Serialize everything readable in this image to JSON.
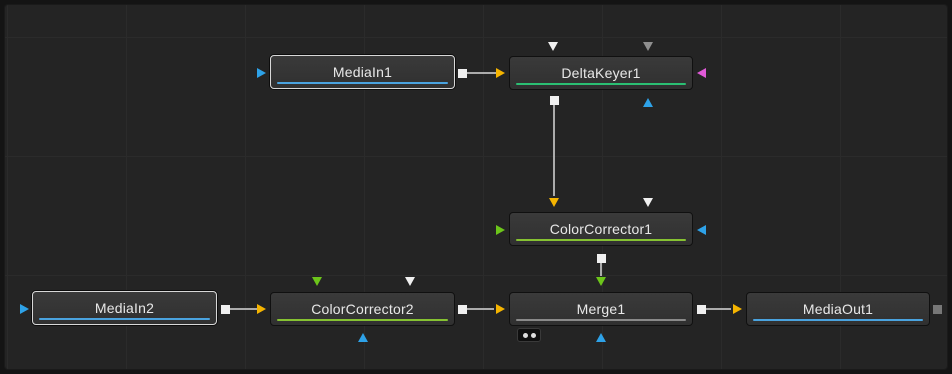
{
  "nodes": {
    "mediain1": {
      "label": "MediaIn1",
      "bar_color": "#4aa3df"
    },
    "deltakeyer1": {
      "label": "DeltaKeyer1",
      "bar_color": "#2bbf73"
    },
    "colorcorrector1": {
      "label": "ColorCorrector1",
      "bar_color": "#86c232"
    },
    "mediain2": {
      "label": "MediaIn2",
      "bar_color": "#4aa3df"
    },
    "colorcorrector2": {
      "label": "ColorCorrector2",
      "bar_color": "#86c232"
    },
    "merge1": {
      "label": "Merge1",
      "bar_color": "#8a8a8a"
    },
    "mediaout1": {
      "label": "MediaOut1",
      "bar_color": "#4aa3df"
    }
  },
  "port_colors": {
    "input_blue": "#2ea2e8",
    "input_yellow": "#f5b400",
    "input_green": "#6cc51a",
    "input_magenta": "#e05ad8",
    "input_white": "#f0f0f0",
    "input_gray": "#8f8f8f",
    "output_white": "#f0f0f0"
  }
}
